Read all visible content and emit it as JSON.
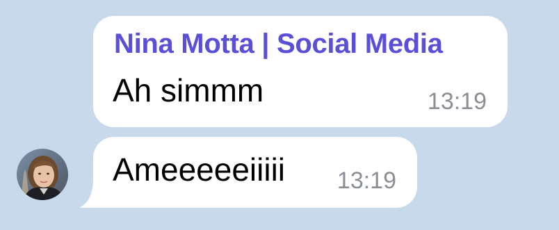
{
  "chat": {
    "messages": [
      {
        "sender": "Nina Motta | Social Media",
        "text": "Ah simmm",
        "time": "13:19"
      },
      {
        "text": "Ameeeeeiiiii",
        "time": "13:19"
      }
    ],
    "avatar_icon": "user-avatar-photo"
  },
  "colors": {
    "background": "#c9d9ec",
    "bubble": "#ffffff",
    "sender_name": "#5a4fd6",
    "timestamp": "#8a8f95"
  }
}
